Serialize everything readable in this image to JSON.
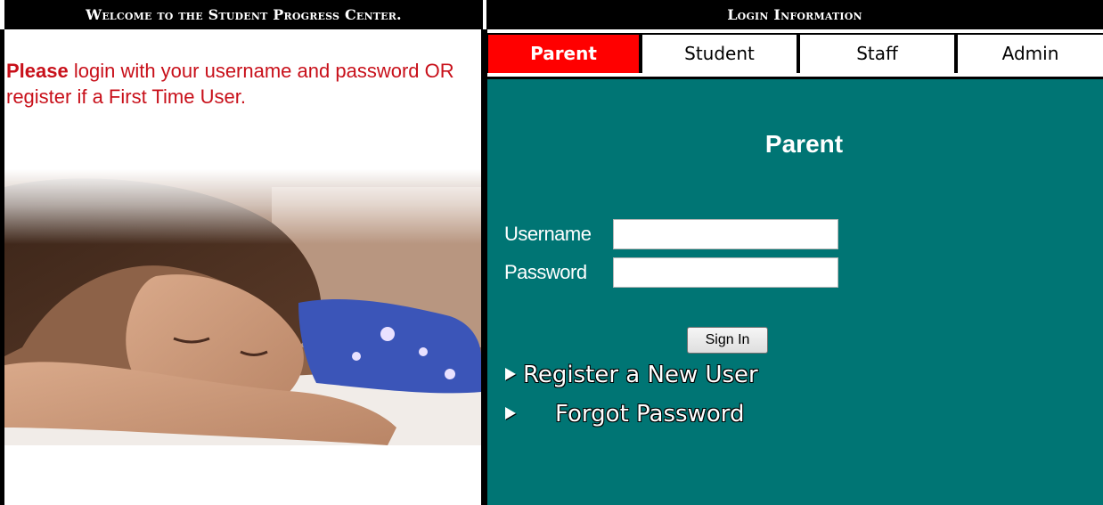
{
  "header": {
    "left_title": "Welcome to the Student Progress Center.",
    "right_title": "Login Information"
  },
  "welcome": {
    "strong": "Please",
    "rest": " login with your username and password OR register if a First Time User."
  },
  "tabs": [
    {
      "label": "Parent",
      "active": true
    },
    {
      "label": "Student",
      "active": false
    },
    {
      "label": "Staff",
      "active": false
    },
    {
      "label": "Admin",
      "active": false
    }
  ],
  "login": {
    "title": "Parent",
    "username_label": "Username",
    "username_value": "",
    "password_label": "Password",
    "password_value": "",
    "signin_label": "Sign In",
    "register_link": "Register a New User",
    "forgot_link": "Forgot Password"
  },
  "colors": {
    "accent": "#ff0000",
    "panel": "#007574",
    "text_red": "#c8101a"
  },
  "icons": {
    "link_arrow": "triangle-right-icon"
  }
}
